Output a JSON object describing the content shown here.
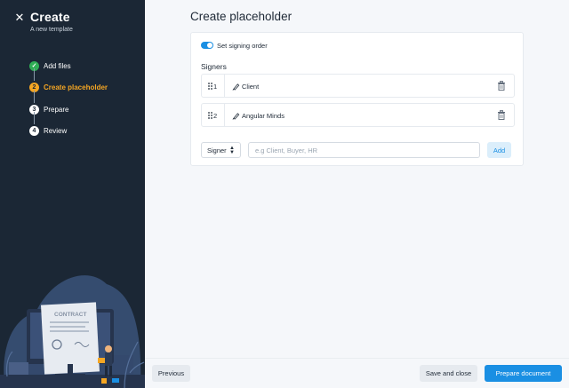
{
  "sidebar": {
    "close_icon": "close-icon",
    "title": "Create",
    "subtitle": "A new template",
    "steps": [
      {
        "number": "✓",
        "label": "Add files",
        "state": "done"
      },
      {
        "number": "2",
        "label": "Create placeholder",
        "state": "active"
      },
      {
        "number": "3",
        "label": "Prepare",
        "state": "pending"
      },
      {
        "number": "4",
        "label": "Review",
        "state": "pending"
      }
    ],
    "illustration": {
      "document_label": "CONTRACT"
    }
  },
  "main": {
    "title": "Create placeholder",
    "signing_order": {
      "label": "Set signing order",
      "enabled": true
    },
    "signers_heading": "Signers",
    "signers": [
      {
        "order": "1",
        "name": "Client"
      },
      {
        "order": "2",
        "name": "Angular Minds"
      }
    ],
    "new_signer": {
      "role_value": "Signer",
      "name_placeholder": "e.g Client, Buyer, HR",
      "add_label": "Add"
    }
  },
  "footer": {
    "previous_label": "Previous",
    "save_close_label": "Save and close",
    "prepare_label": "Prepare document"
  },
  "colors": {
    "sidebar_bg": "#1b2735",
    "accent": "#1a8fe3",
    "step_done": "#2fae55",
    "step_active": "#f5a623"
  }
}
